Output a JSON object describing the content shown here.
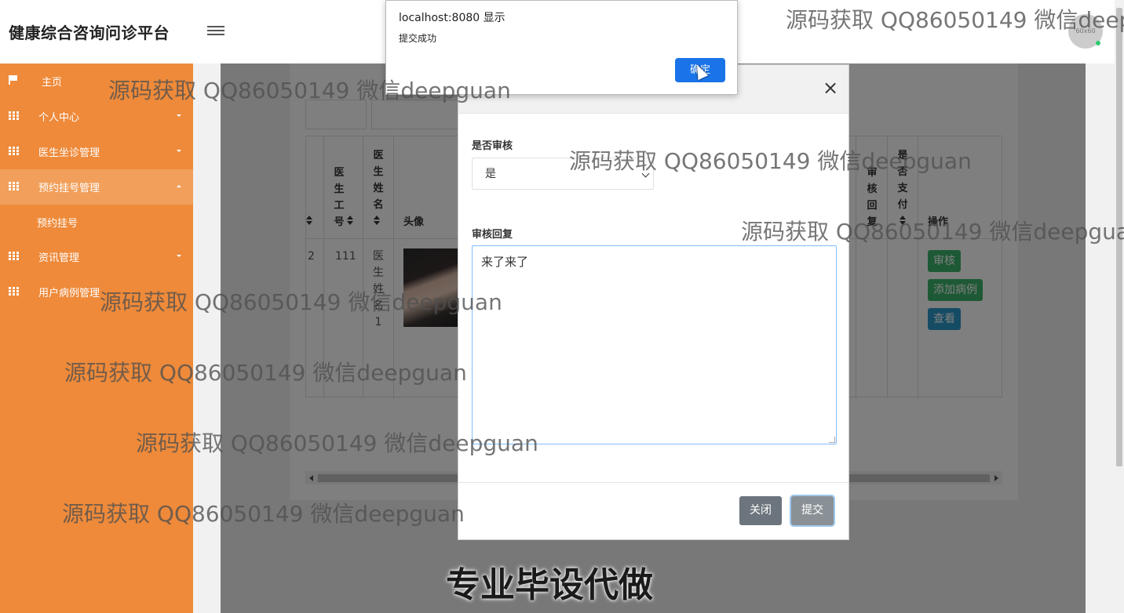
{
  "header": {
    "brand": "健康综合咨询问诊平台",
    "avatar_text": "60x60"
  },
  "sidebar": {
    "items": [
      {
        "label": "主页",
        "icon": "flag-icon"
      },
      {
        "label": "个人中心",
        "icon": "grid-icon"
      },
      {
        "label": "医生坐诊管理",
        "icon": "grid-icon"
      },
      {
        "label": "预约挂号管理",
        "icon": "grid-icon"
      },
      {
        "label": "资讯管理",
        "icon": "grid-icon"
      },
      {
        "label": "用户病例管理",
        "icon": "grid-icon"
      }
    ],
    "sub_items": [
      {
        "label": "预约挂号"
      }
    ]
  },
  "table": {
    "headers": {
      "doctor_id": "医生工号",
      "doctor_name": "医生姓名",
      "avatar": "头像",
      "review_reply": "审核回复",
      "is_paid": "是否支付",
      "actions": "操作"
    },
    "row": {
      "index": "2",
      "doctor_id": "111",
      "doctor_name": "医生姓名1"
    },
    "buttons": {
      "review": "审核",
      "add_case": "添加病例",
      "view": "查看"
    }
  },
  "modal": {
    "close_symbol": "×",
    "review_label": "是否审核",
    "review_value": "是",
    "reply_label": "审核回复",
    "reply_value": "来了来了",
    "close_button": "关闭",
    "submit_button": "提交"
  },
  "alert": {
    "title": "localhost:8080 显示",
    "message": "提交成功",
    "ok_button": "确定"
  },
  "watermarks": {
    "text": "源码获取 QQ86050149 微信deepguan",
    "banner": "专业毕设代做"
  }
}
